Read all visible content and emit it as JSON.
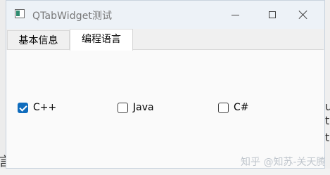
{
  "window": {
    "title": "QTabWidget测试",
    "controls": {
      "minimize": "minimize-icon",
      "maximize": "maximize-icon",
      "close": "close-icon"
    }
  },
  "tabs": [
    {
      "label": "基本信息",
      "selected": false
    },
    {
      "label": "编程语言",
      "selected": true
    }
  ],
  "checkboxes": [
    {
      "label": "C++",
      "checked": true
    },
    {
      "label": "Java",
      "checked": false
    },
    {
      "label": "C#",
      "checked": false
    }
  ],
  "background": {
    "left_glyph": "言",
    "right_glyphs": [
      "u",
      "t",
      "t"
    ]
  },
  "watermark": "知乎 @知苏-关天腾",
  "colors": {
    "accent": "#0f6cbd",
    "titlebar": "#edf2f7",
    "tab_selected": "#ffffff"
  }
}
